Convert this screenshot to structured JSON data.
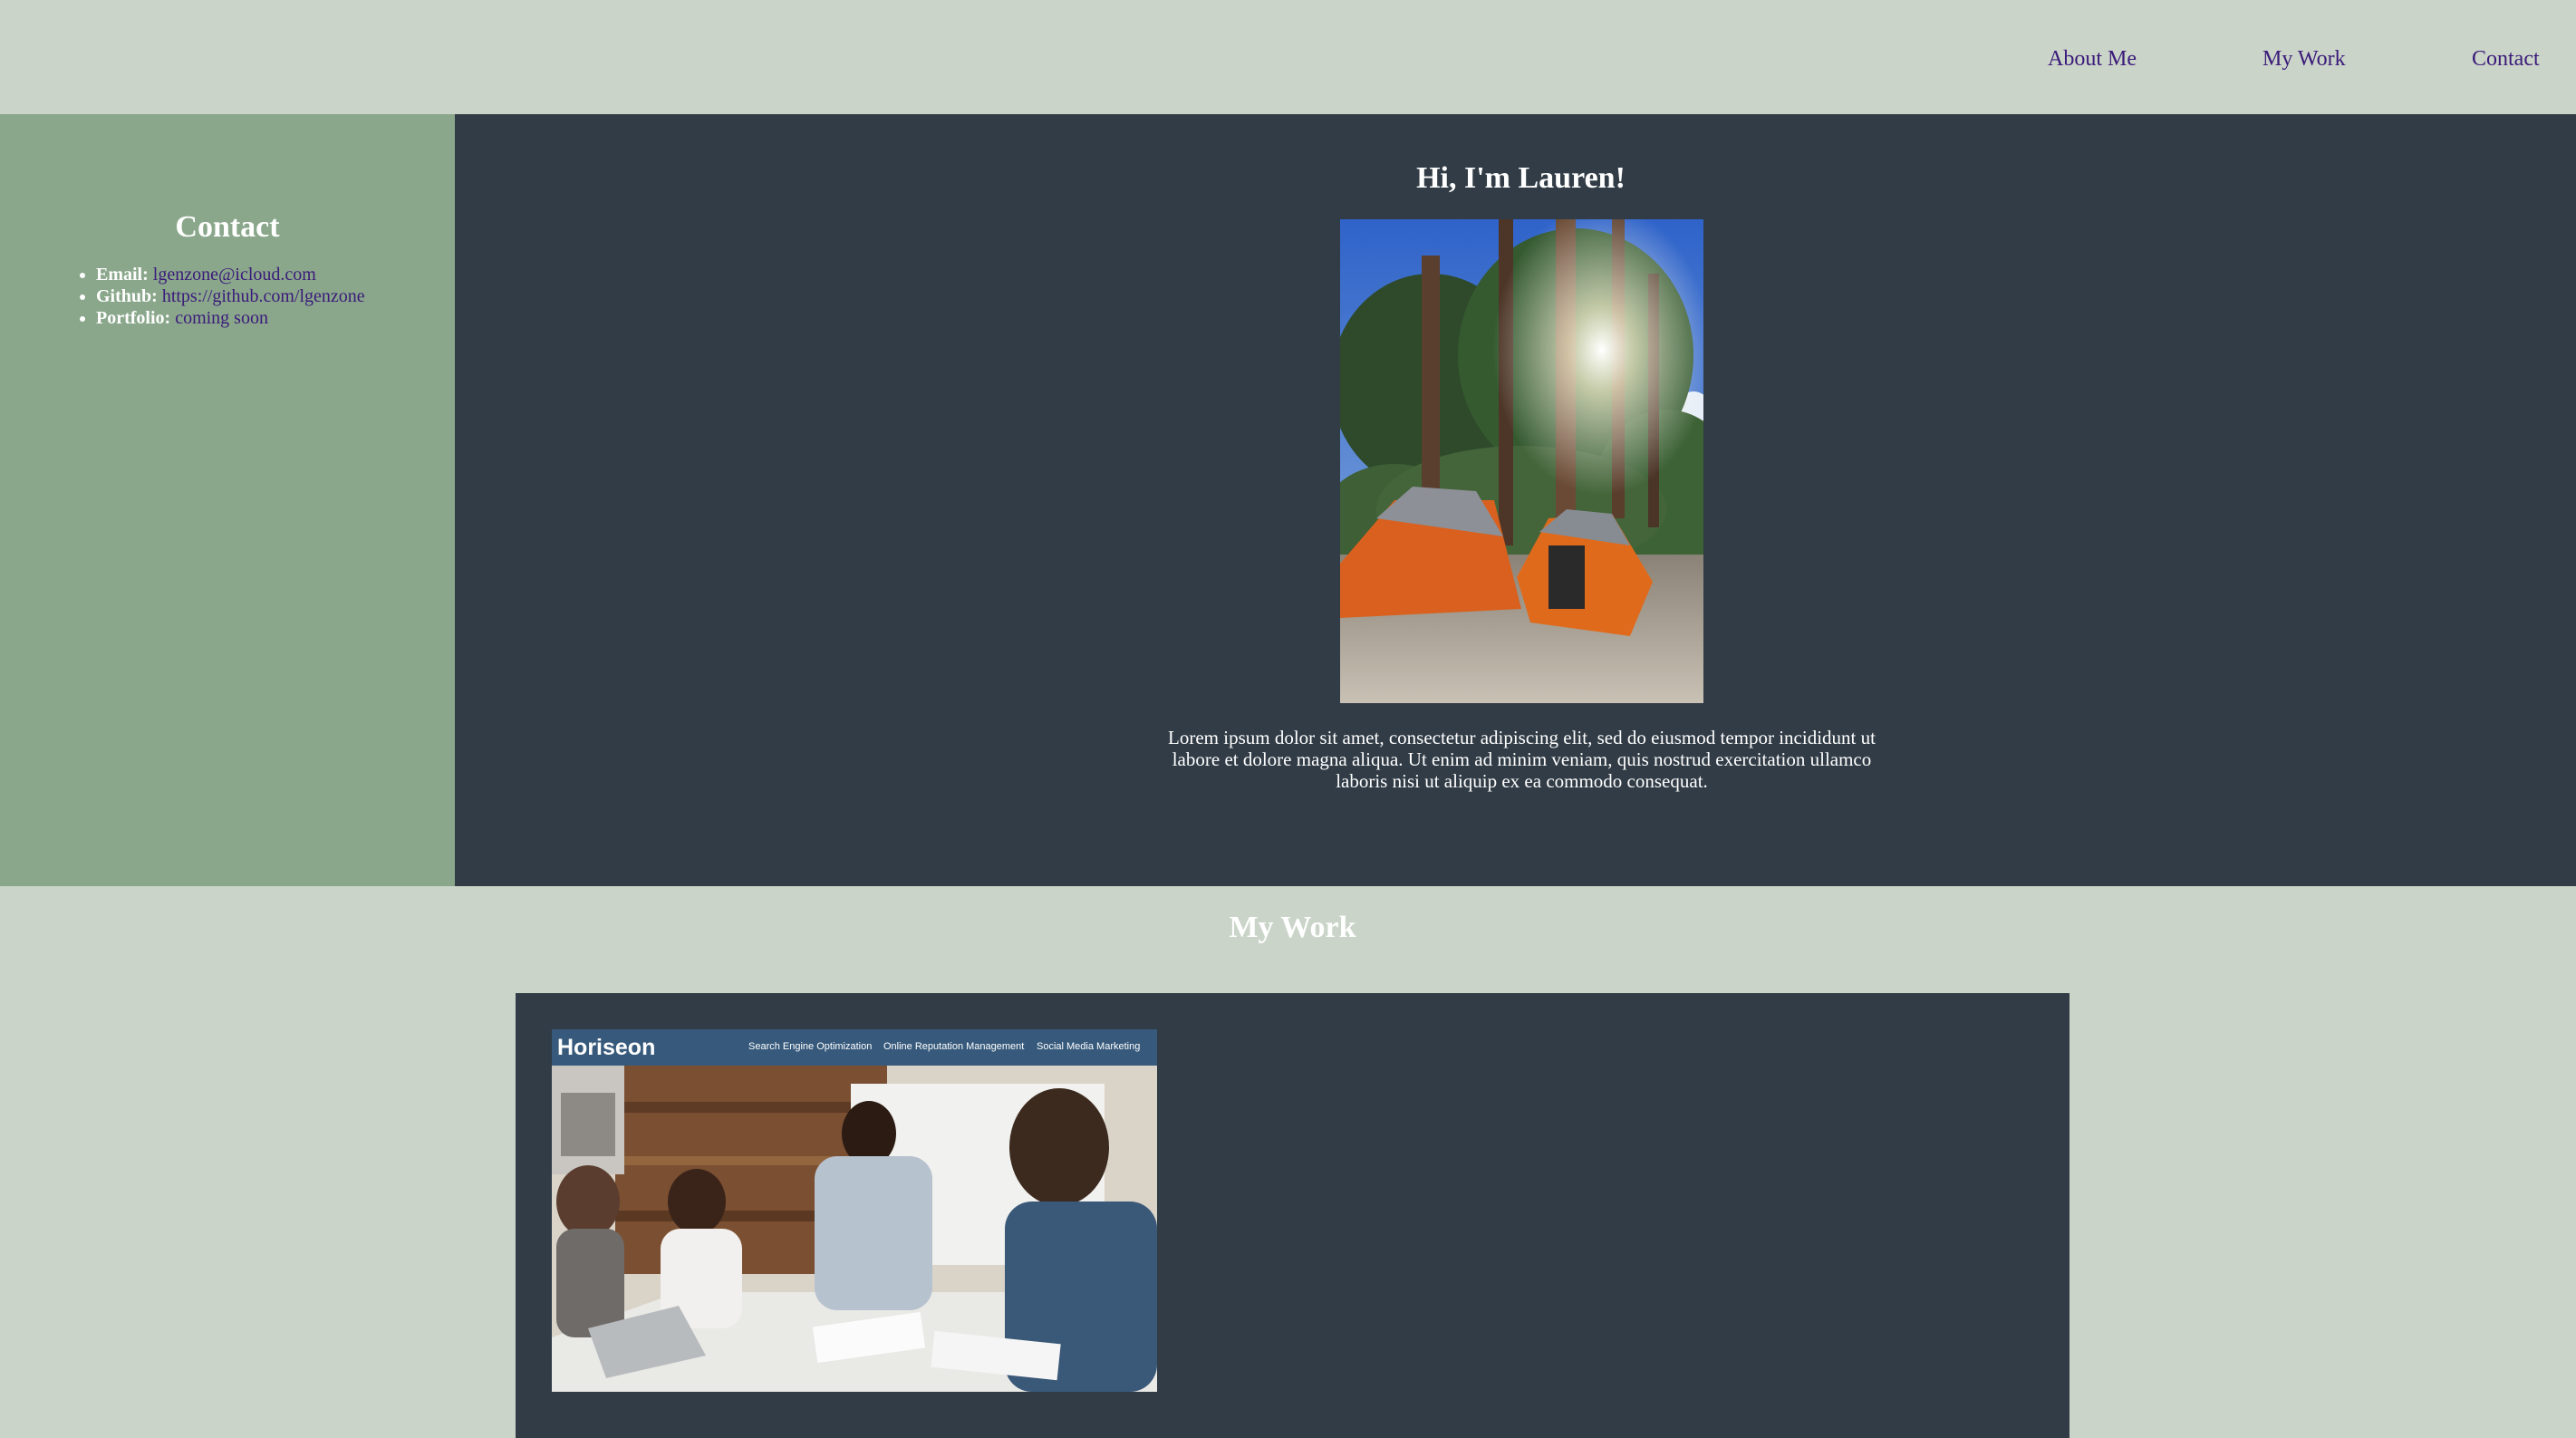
{
  "nav": {
    "about": "About Me",
    "work": "My Work",
    "contact": "Contact"
  },
  "sidebar": {
    "title": "Contact",
    "items": [
      {
        "label": "Email:",
        "value": "lgenzone@icloud.com"
      },
      {
        "label": "Github:",
        "value": "https://github.com/lgenzone"
      },
      {
        "label": "Portfolio:",
        "value": "coming soon"
      }
    ]
  },
  "about": {
    "heading": "Hi, I'm Lauren!",
    "paragraph": "Lorem ipsum dolor sit amet, consectetur adipiscing elit, sed do eiusmod tempor incididunt ut labore et dolore magna aliqua. Ut enim ad minim veniam, quis nostrud exercitation ullamco laboris nisi ut aliquip ex ea commodo consequat."
  },
  "work": {
    "heading": "My Work",
    "project": {
      "logo": "Horiseon",
      "nav": [
        "Search Engine Optimization",
        "Online Reputation Management",
        "Social Media Marketing"
      ]
    }
  },
  "colors": {
    "header_bg": "#cad4c8",
    "sidebar_bg": "#8aa78b",
    "main_bg": "#313c46",
    "link": "#3a1a7a",
    "horiseon_bar": "#375a7c"
  }
}
